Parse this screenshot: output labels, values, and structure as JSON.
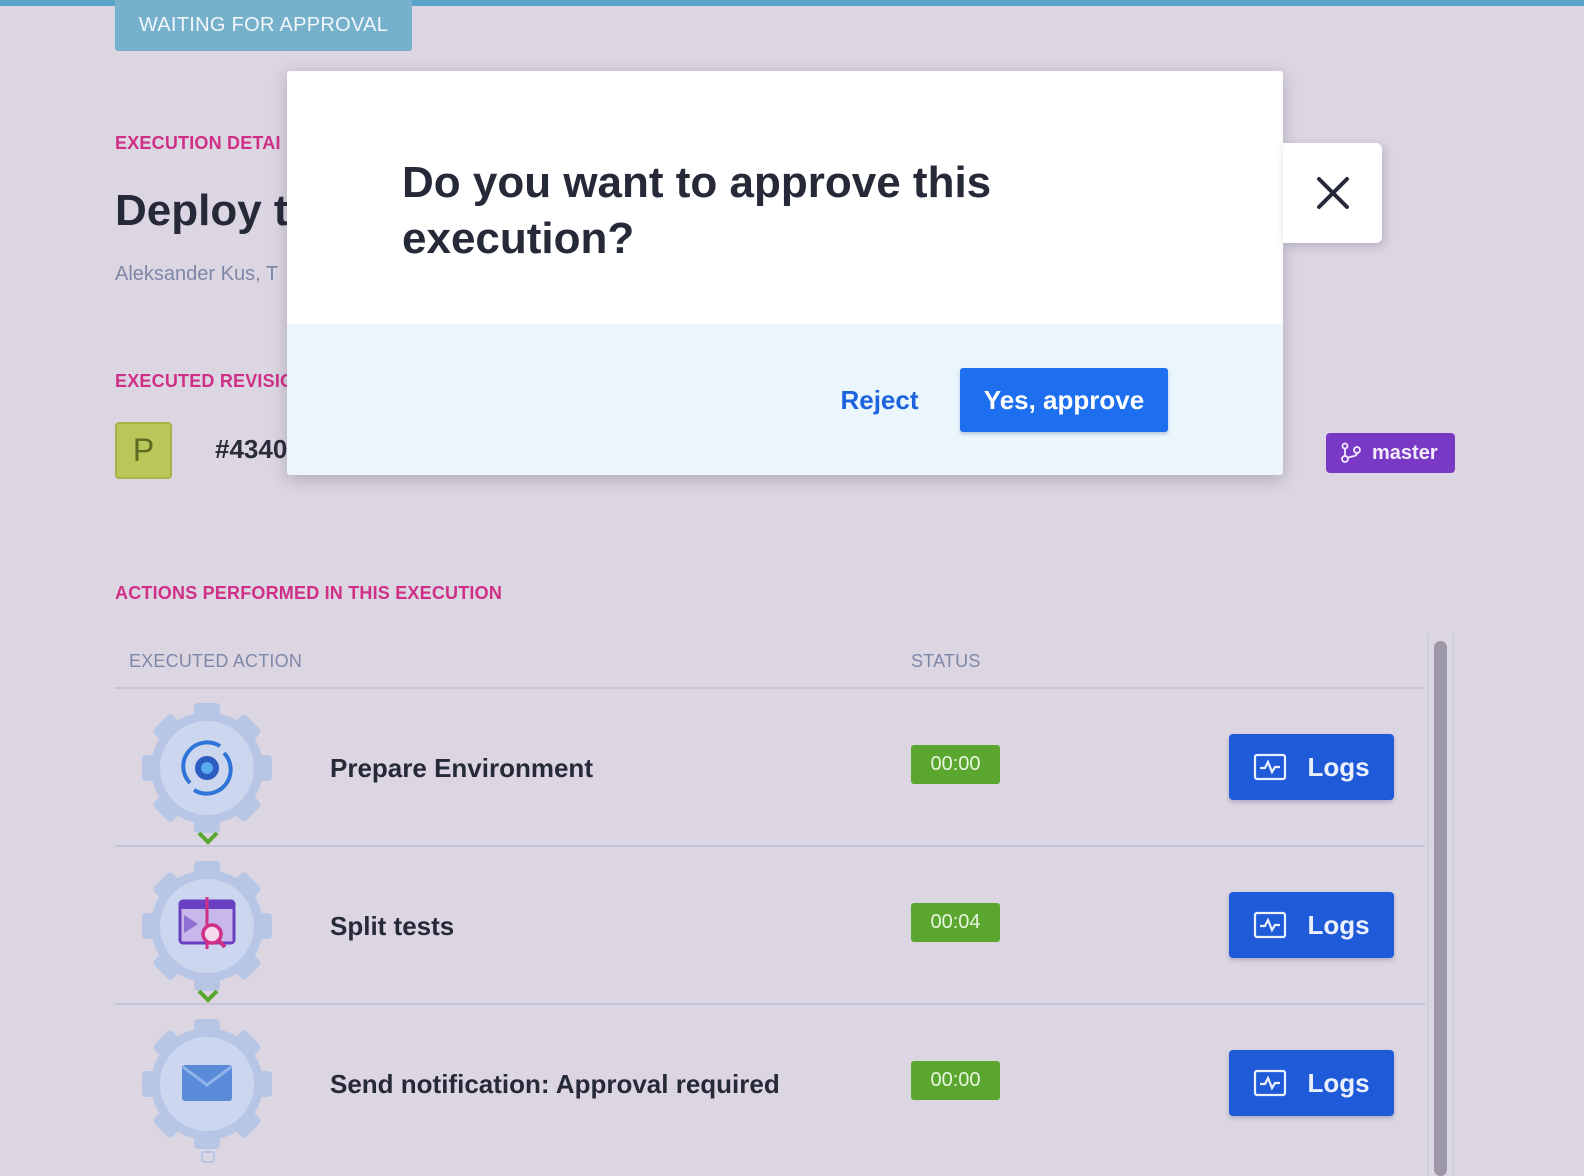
{
  "status_tag": "WAITING FOR APPROVAL",
  "execution": {
    "section_label": "EXECUTION DETAI",
    "title": "Deploy t",
    "authors": "Aleksander Kus, T"
  },
  "revision": {
    "section_label": "EXECUTED REVISIO",
    "avatar_letter": "P",
    "number": "#4340",
    "branch": "master"
  },
  "actions": {
    "section_label": "ACTIONS PERFORMED IN THIS EXECUTION",
    "columns": {
      "action": "EXECUTED ACTION",
      "status": "STATUS"
    },
    "logs_label": "Logs",
    "rows": [
      {
        "name": "Prepare Environment",
        "duration": "00:00",
        "icon": "environment-gear-icon"
      },
      {
        "name": "Split tests",
        "duration": "00:04",
        "icon": "split-tests-icon"
      },
      {
        "name": "Send notification: Approval required",
        "duration": "00:00",
        "icon": "envelope-icon"
      }
    ]
  },
  "modal": {
    "title": "Do you want to approve this execution?",
    "reject_label": "Reject",
    "approve_label": "Yes, approve"
  },
  "colors": {
    "accent_pink": "#cf2f86",
    "primary_blue": "#1d6ff0",
    "success_green": "#5aa62e",
    "branch_purple": "#7a39c4"
  }
}
